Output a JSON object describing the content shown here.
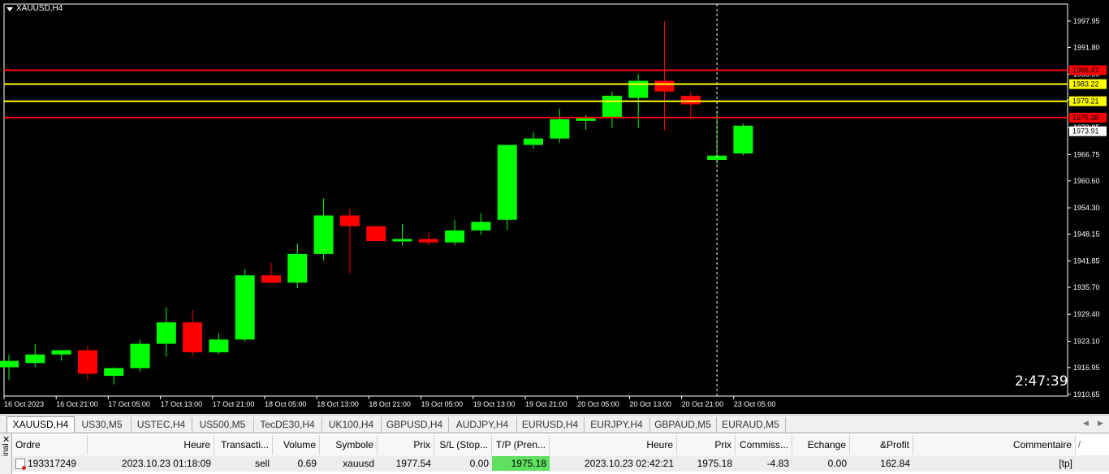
{
  "window": {
    "symbol_label": "XAUUSD,H4",
    "timer": "2:47:39"
  },
  "colors": {
    "bull": "#00ff00",
    "bear": "#ff0000",
    "sl_line": "#ff0000",
    "tp_line": "#ffff00",
    "background": "#000000"
  },
  "chart_data": {
    "type": "candlestick",
    "symbol": "XAUUSD",
    "timeframe": "H4",
    "y_ticks": [
      "1997.95",
      "1991.80",
      "1985.50",
      "1979.55",
      "1973.05",
      "1966.75",
      "1960.60",
      "1954.30",
      "1948.15",
      "1941.85",
      "1935.70",
      "1929.40",
      "1923.10",
      "1916.95",
      "1910.65"
    ],
    "ylim": [
      1910.65,
      2000
    ],
    "x_ticks": [
      "16 Oct 2023",
      "16 Oct 21:00",
      "17 Oct 05:00",
      "17 Oct 13:00",
      "17 Oct 21:00",
      "18 Oct 05:00",
      "18 Oct 13:00",
      "18 Oct 21:00",
      "19 Oct 05:00",
      "19 Oct 13:00",
      "19 Oct 21:00",
      "20 Oct 05:00",
      "20 Oct 13:00",
      "20 Oct 21:00",
      "23 Oct 05:00"
    ],
    "candles": [
      {
        "o": 1917.0,
        "h": 1920.0,
        "l": 1914.0,
        "c": 1918.5
      },
      {
        "o": 1918.0,
        "h": 1922.5,
        "l": 1917.0,
        "c": 1920.0
      },
      {
        "o": 1920.0,
        "h": 1921.0,
        "l": 1918.5,
        "c": 1921.0
      },
      {
        "o": 1921.0,
        "h": 1922.0,
        "l": 1914.0,
        "c": 1915.5
      },
      {
        "o": 1915.0,
        "h": 1917.0,
        "l": 1913.0,
        "c": 1916.8
      },
      {
        "o": 1916.8,
        "h": 1923.5,
        "l": 1916.0,
        "c": 1922.5
      },
      {
        "o": 1922.5,
        "h": 1931.0,
        "l": 1919.5,
        "c": 1927.5
      },
      {
        "o": 1927.5,
        "h": 1930.5,
        "l": 1919.5,
        "c": 1920.5
      },
      {
        "o": 1920.5,
        "h": 1925.0,
        "l": 1920.0,
        "c": 1923.5
      },
      {
        "o": 1923.5,
        "h": 1940.0,
        "l": 1923.0,
        "c": 1938.5
      },
      {
        "o": 1938.5,
        "h": 1941.5,
        "l": 1937.0,
        "c": 1936.8
      },
      {
        "o": 1936.8,
        "h": 1946.0,
        "l": 1935.5,
        "c": 1943.5
      },
      {
        "o": 1943.5,
        "h": 1956.5,
        "l": 1942.0,
        "c": 1952.5
      },
      {
        "o": 1952.5,
        "h": 1954.0,
        "l": 1939.0,
        "c": 1950.0
      },
      {
        "o": 1950.0,
        "h": 1950.0,
        "l": 1946.5,
        "c": 1946.5
      },
      {
        "o": 1946.5,
        "h": 1950.5,
        "l": 1945.5,
        "c": 1947.0
      },
      {
        "o": 1947.0,
        "h": 1948.5,
        "l": 1945.5,
        "c": 1946.2
      },
      {
        "o": 1946.2,
        "h": 1951.5,
        "l": 1945.5,
        "c": 1949.0
      },
      {
        "o": 1949.0,
        "h": 1953.0,
        "l": 1948.0,
        "c": 1951.0
      },
      {
        "o": 1951.5,
        "h": 1964.0,
        "l": 1949.0,
        "c": 1969.0
      },
      {
        "o": 1969.0,
        "h": 1972.0,
        "l": 1968.0,
        "c": 1970.5
      },
      {
        "o": 1970.5,
        "h": 1977.5,
        "l": 1969.5,
        "c": 1975.0
      },
      {
        "o": 1975.0,
        "h": 1976.0,
        "l": 1972.5,
        "c": 1975.2
      },
      {
        "o": 1975.5,
        "h": 1981.5,
        "l": 1973.0,
        "c": 1980.5
      },
      {
        "o": 1980.0,
        "h": 1985.5,
        "l": 1973.0,
        "c": 1984.0
      },
      {
        "o": 1984.0,
        "h": 1998.0,
        "l": 1972.5,
        "c": 1981.5
      },
      {
        "o": 1980.5,
        "h": 1981.5,
        "l": 1975.0,
        "c": 1978.5
      },
      {
        "o": 1965.5,
        "h": 1977.0,
        "l": 1964.5,
        "c": 1966.5
      },
      {
        "o": 1967.0,
        "h": 1974.0,
        "l": 1966.5,
        "c": 1973.5
      }
    ],
    "levels": [
      {
        "label": "1986.47",
        "price": 1986.47,
        "kind": "sl"
      },
      {
        "label": "1983.22",
        "price": 1983.22,
        "kind": "tp"
      },
      {
        "label": "1979.21",
        "price": 1979.21,
        "kind": "tp"
      },
      {
        "label": "1975.38",
        "price": 1975.38,
        "kind": "sl"
      }
    ],
    "bid_label": "1973.91",
    "crosshair_candle_index": 27
  },
  "tabs": [
    "XAUUSD,H4",
    "US30,M5",
    "USTEC,H4",
    "US500,M5",
    "TecDE30,H4",
    "UK100,H4",
    "GBPUSD,H4",
    "AUDJPY,H4",
    "EURUSD,H4",
    "EURJPY,H4",
    "GBPAUD,M5",
    "EURAUD,M5"
  ],
  "terminal": {
    "side_label": "inal",
    "headers": [
      "Ordre",
      "Heure",
      "Transacti...",
      "Volume",
      "Symbole",
      "Prix",
      "S/L (Stop...",
      "T/P (Pren...",
      "Heure",
      "Prix",
      "Commiss...",
      "Echange",
      "&Profit",
      "Commentaire"
    ],
    "row": [
      "193317249",
      "2023.10.23 01:18:09",
      "sell",
      "0.69",
      "xauusd",
      "1977.54",
      "0.00",
      "1975.18",
      "2023.10.23 02:42:21",
      "1975.18",
      "-4.83",
      "0.00",
      "162.84",
      "[tp]"
    ]
  }
}
